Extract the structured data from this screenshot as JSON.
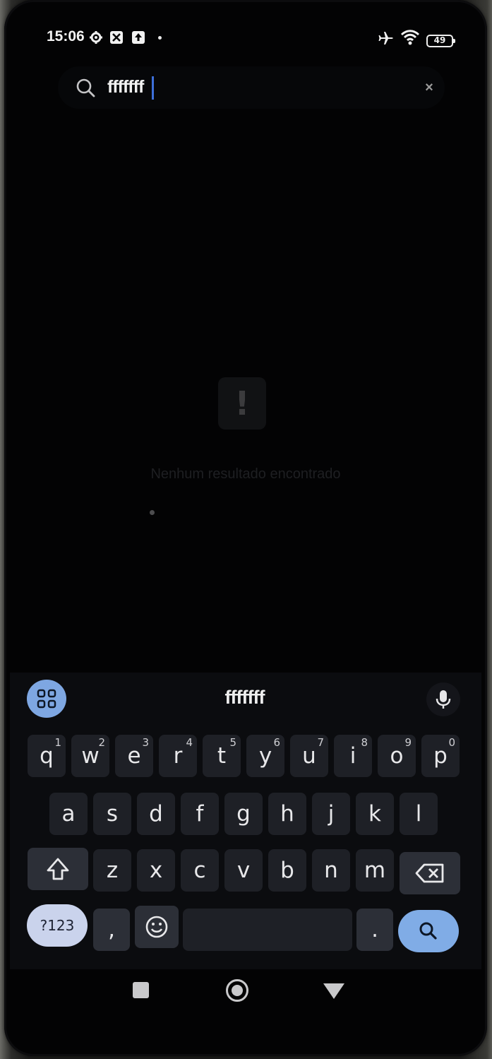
{
  "status_bar": {
    "time": "15:06",
    "battery": "49",
    "icons": [
      "gear-icon",
      "crossed-square-icon",
      "upload-icon",
      "dot-indicator",
      "airplane-icon",
      "wifi-icon",
      "battery-icon"
    ]
  },
  "search": {
    "query": "fffffff",
    "clear_label": "×",
    "icon": "search-icon"
  },
  "empty_state": {
    "icon_glyph": "!",
    "message": "Nenhum resultado encontrado"
  },
  "keyboard": {
    "suggestion": "fffffff",
    "row1": [
      {
        "key": "q",
        "hint": "1"
      },
      {
        "key": "w",
        "hint": "2"
      },
      {
        "key": "e",
        "hint": "3"
      },
      {
        "key": "r",
        "hint": "4"
      },
      {
        "key": "t",
        "hint": "5"
      },
      {
        "key": "y",
        "hint": "6"
      },
      {
        "key": "u",
        "hint": "7"
      },
      {
        "key": "i",
        "hint": "8"
      },
      {
        "key": "o",
        "hint": "9"
      },
      {
        "key": "p",
        "hint": "0"
      }
    ],
    "row2": [
      "a",
      "s",
      "d",
      "f",
      "g",
      "h",
      "j",
      "k",
      "l"
    ],
    "row3": [
      "z",
      "x",
      "c",
      "v",
      "b",
      "n",
      "m"
    ],
    "symbols_label": "?123",
    "comma_label": ",",
    "period_label": ".",
    "colors": {
      "accent": "#80ace6",
      "symbols_bg": "#cad3ec",
      "key_bg": "#1e2026"
    }
  },
  "nav_bar": {
    "icons": [
      "recents-icon",
      "home-icon",
      "back-icon"
    ]
  }
}
